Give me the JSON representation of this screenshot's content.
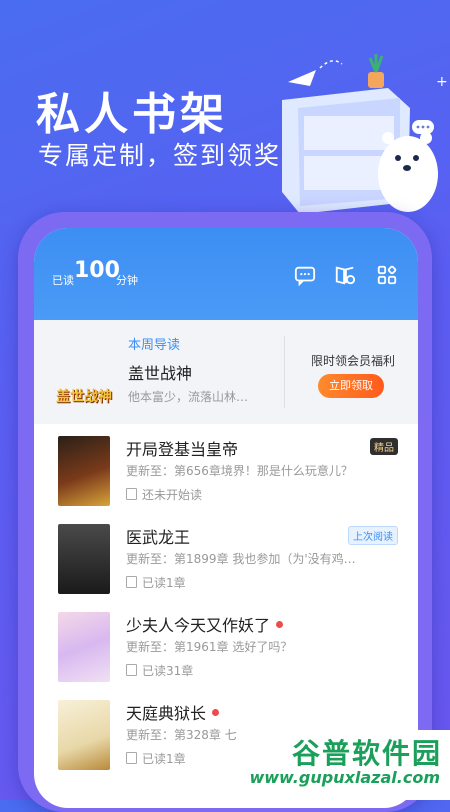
{
  "hero": {
    "title": "私人书架",
    "subtitle": "专属定制，签到领奖"
  },
  "topbar": {
    "read_prefix": "已读",
    "read_minutes": "100",
    "read_unit": "分钟"
  },
  "weekly": {
    "tag": "本周导读",
    "title": "盖世战神",
    "desc": "他本富少，流落山林…",
    "cover_text": "盖世战神",
    "promo": "限时领会员福利",
    "button": "立即领取"
  },
  "books": [
    {
      "title": "开局登基当皇帝",
      "update": "更新至：第656章境界！那是什么玩意儿？",
      "progress": "还未开始读",
      "badge": "精品",
      "dot": false
    },
    {
      "title": "医武龙王",
      "update": "更新至：第1899章 我也参加（为'没有鸡…",
      "progress": "已读1章",
      "badge": "上次阅读",
      "dot": false
    },
    {
      "title": "少夫人今天又作妖了",
      "update": "更新至：第1961章 选好了吗？",
      "progress": "已读31章",
      "badge": "",
      "dot": true
    },
    {
      "title": "天庭典狱长",
      "update": "更新至：第328章 七",
      "progress": "已读1章",
      "badge": "",
      "dot": true
    }
  ],
  "watermark": {
    "text_cn": "谷普软件园",
    "url": "www.gupuxlazal.com"
  }
}
